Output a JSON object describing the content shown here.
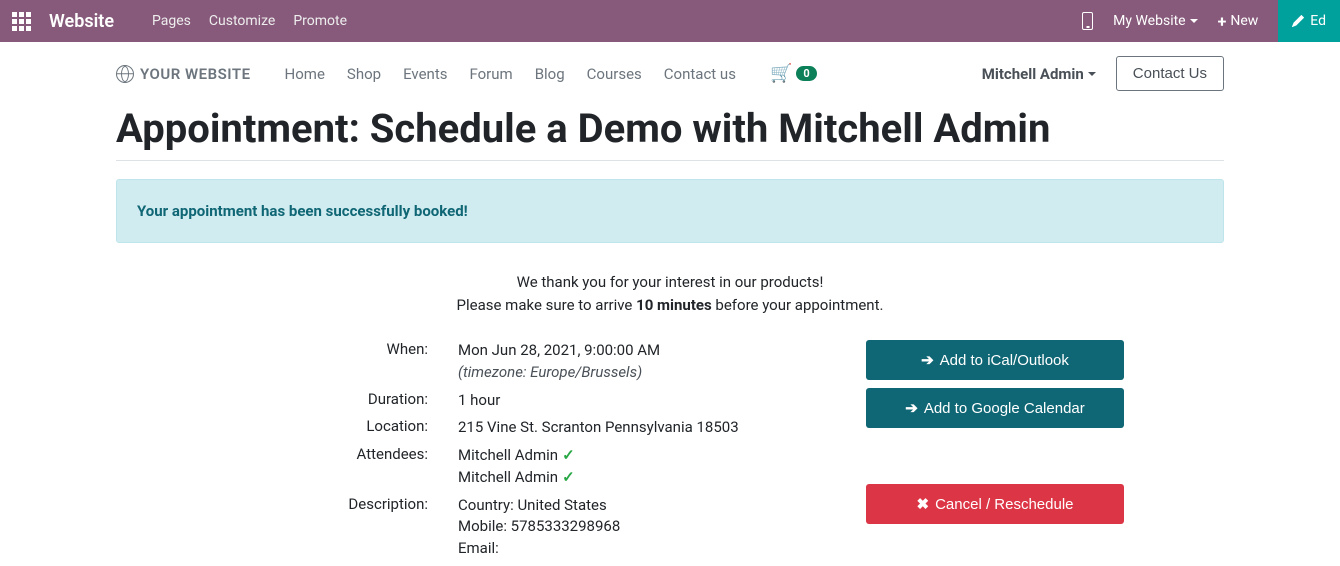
{
  "top_bar": {
    "brand": "Website",
    "nav": [
      "Pages",
      "Customize",
      "Promote"
    ],
    "my_website": "My Website",
    "new_label": "New",
    "edit_label": "Ed"
  },
  "site": {
    "logo_text": "YOUR WEBSITE",
    "nav": [
      "Home",
      "Shop",
      "Events",
      "Forum",
      "Blog",
      "Courses",
      "Contact us"
    ],
    "cart_count": "0",
    "user_name": "Mitchell Admin",
    "contact_btn": "Contact Us"
  },
  "page": {
    "title": "Appointment: Schedule a Demo with Mitchell Admin",
    "alert": "Your appointment has been successfully booked!",
    "intro_line1": "We thank you for your interest in our products!",
    "intro_line2_prefix": "Please make sure to arrive ",
    "intro_line2_bold": "10 minutes",
    "intro_line2_suffix": " before your appointment."
  },
  "details": {
    "when_label": "When:",
    "when_value": "Mon Jun 28, 2021, 9:00:00 AM",
    "when_tz": "(timezone: Europe/Brussels)",
    "duration_label": "Duration:",
    "duration_value": "1 hour",
    "location_label": "Location:",
    "location_value": "215 Vine St. Scranton Pennsylvania 18503",
    "attendees_label": "Attendees:",
    "attendees": [
      "Mitchell Admin",
      "Mitchell Admin"
    ],
    "description_label": "Description:",
    "description_lines": [
      "Country: United States",
      "Mobile: 5785333298968",
      "Email:"
    ]
  },
  "actions": {
    "ical": "Add to iCal/Outlook",
    "gcal": "Add to Google Calendar",
    "cancel": "Cancel / Reschedule"
  }
}
